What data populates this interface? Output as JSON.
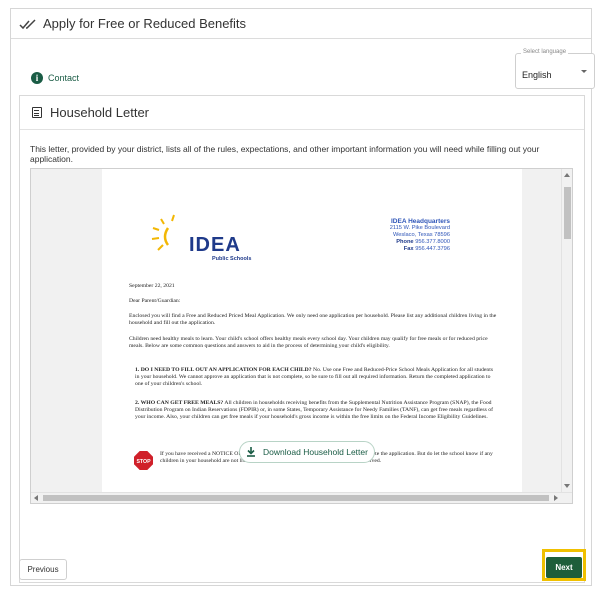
{
  "header": {
    "title": "Apply for Free or Reduced Benefits",
    "icon": "double-check-icon"
  },
  "contact": {
    "label": "Contact",
    "icon": "info-icon"
  },
  "language": {
    "label": "Select language",
    "value": "English"
  },
  "card": {
    "title": "Household Letter",
    "intro": "This letter, provided by your district, lists all of the rules, expectations, and other important information you will need while filling out your application."
  },
  "letter": {
    "logo_text": "IDEA",
    "logo_sub": "Public Schools",
    "hq": {
      "name": "IDEA Headquarters",
      "street": "2115 W. Pike Boulevard",
      "city": "Weslaco, Texas 78596",
      "phone_label": "Phone",
      "phone": "956.377.8000",
      "fax_label": "Fax",
      "fax": "956.447.3796"
    },
    "date": "September 22, 2021",
    "greeting": "Dear Parent/Guardian:",
    "p1": "Enclosed you will find a Free and Reduced Priced Meal Application. We only need one application per household. Please list any additional children living in the household and fill out the application.",
    "p2": "Children need healthy meals to learn. Your child's school offers healthy meals every school day. Your children may qualify for free meals or for reduced price meals. Below are some common questions and answers to aid in the process of determining your child's eligibility.",
    "q1_head": "1.   DO I NEED TO FILL OUT AN APPLICATION FOR EACH CHILD?",
    "q1_body": " No. Use one Free and Reduced-Price School Meals Application for all students in your household. We cannot approve an application that is not complete, so be sure to fill out all required information. Return the completed application to one of your children's school.",
    "q2_head": "2.   WHO CAN GET FREE MEALS?",
    "q2_body": " All children in households receiving benefits from the Supplemental Nutrition Assistance Program (SNAP), the Food Distribution Program on Indian Reservations (FDPIR) or, in some States, Temporary Assistance for Needy Families (TANF), can get free meals regardless of your income. Also, your children can get free meals if your household's gross income is within the free limits on the Federal Income Eligibility Guidelines.",
    "stop_label": "STOP",
    "stop_text": "If you have received a NOTICE OF DIRECT CERTIFICATION for free meals, do not complete the application. But do let the school know if any children in your household are not listed on the Notice of Direct Certification letter you received."
  },
  "actions": {
    "download": "Download Household Letter",
    "previous": "Previous",
    "next": "Next"
  },
  "colors": {
    "brand_green": "#1e5e3a",
    "highlight": "#f0c000",
    "logo_blue": "#1f3a8a",
    "logo_yellow": "#f2b705"
  }
}
